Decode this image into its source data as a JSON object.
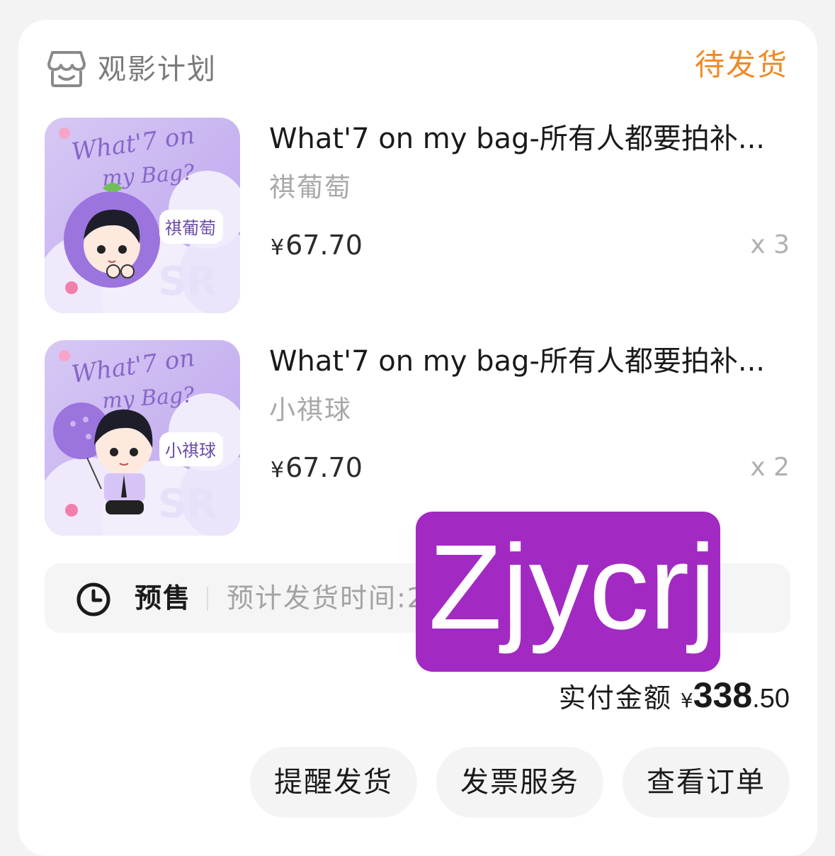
{
  "store": {
    "name": "观影计划",
    "icon": "store-icon"
  },
  "order_status": "待发货",
  "items": [
    {
      "title": "What'7 on my bag-所有人都要拍补...",
      "variant": "祺葡萄",
      "price_symbol": "¥",
      "price": "67.70",
      "quantity": "x 3",
      "thumb": {
        "headline_1": "What'7 on",
        "headline_2": "my Bag?",
        "badge": "祺葡萄",
        "mark": "SR"
      }
    },
    {
      "title": "What'7 on my bag-所有人都要拍补...",
      "variant": "小祺球",
      "price_symbol": "¥",
      "price": "67.70",
      "quantity": "x 2",
      "thumb": {
        "headline_1": "What'7 on",
        "headline_2": "my Bag?",
        "badge": "小祺球",
        "mark": "SR"
      }
    }
  ],
  "presale": {
    "icon": "clock-icon",
    "label": "预售",
    "text": "预计发货时间:2"
  },
  "watermark": "Zjycrj",
  "total": {
    "label": "实付金额",
    "symbol": "¥",
    "integer": "338",
    "decimal": ".50"
  },
  "actions": [
    "提醒发货",
    "发票服务",
    "查看订单"
  ],
  "colors": {
    "status": "#f08a24",
    "watermark_bg": "#a22ac3",
    "thumb_bg": "#c9b4ef"
  }
}
